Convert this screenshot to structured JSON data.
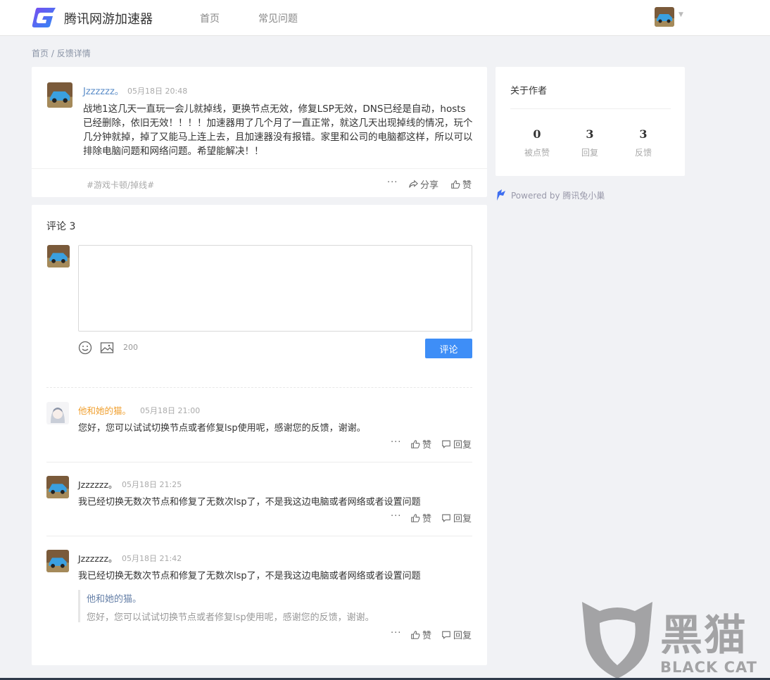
{
  "header": {
    "brand": "腾讯网游加速器",
    "nav": [
      "首页",
      "常见问题"
    ]
  },
  "breadcrumb": {
    "home": "首页",
    "sep": " / ",
    "current": "反馈详情"
  },
  "post": {
    "author": "Jzzzzzz。",
    "time": "05月18日 20:48",
    "body": "战地1这几天一直玩一会儿就掉线，更换节点无效，修复LSP无效，DNS已经是自动，hosts已经删除，依旧无效！！！！加速器用了几个月了一直正常，就这几天出现掉线的情况，玩个几分钟就掉，掉了又能马上连上去，且加速器没有报错。家里和公司的电脑都这样，所以可以排除电脑问题和网络问题。希望能解决！！",
    "tag": "#游戏卡顿/掉线#",
    "more": "···",
    "share_label": "分享",
    "like_label": "赞"
  },
  "about": {
    "title": "关于作者",
    "stats": [
      {
        "value": "0",
        "label": "被点赞"
      },
      {
        "value": "3",
        "label": "回复"
      },
      {
        "value": "3",
        "label": "反馈"
      }
    ]
  },
  "powered": "Powered by 腾讯兔小巢",
  "comments": {
    "title": "评论 3",
    "textarea_value": "",
    "char_count": "200",
    "submit_label": "评论",
    "items": [
      {
        "author": "他和她的猫。",
        "author_color": "#f0a030",
        "time": "05月18日 21:00",
        "body": "您好，您可以试试切换节点或者修复lsp使用呢，感谢您的反馈，谢谢。",
        "more": "···",
        "like_label": "赞",
        "reply_label": "回复"
      },
      {
        "author": "Jzzzzzz。",
        "author_color": "#333333",
        "time": "05月18日 21:25",
        "body": "我已经切换无数次节点和修复了无数次lsp了，不是我这边电脑或者网络或者设置问题",
        "more": "···",
        "like_label": "赞",
        "reply_label": "回复"
      },
      {
        "author": "Jzzzzzz。",
        "author_color": "#333333",
        "time": "05月18日 21:42",
        "body": "我已经切换无数次节点和修复了无数次lsp了，不是我这边电脑或者网络或者设置问题",
        "quote": {
          "author": "他和她的猫。",
          "body": "您好，您可以试试切换节点或者修复lsp使用呢，感谢您的反馈，谢谢。"
        },
        "more": "···",
        "like_label": "赞",
        "reply_label": "回复"
      }
    ]
  },
  "watermark": {
    "cn": "黑猫",
    "en": "BLACK CAT"
  },
  "colors": {
    "accent": "#3e8ef7",
    "link": "#5a8cc8",
    "orange": "#f0a030"
  }
}
